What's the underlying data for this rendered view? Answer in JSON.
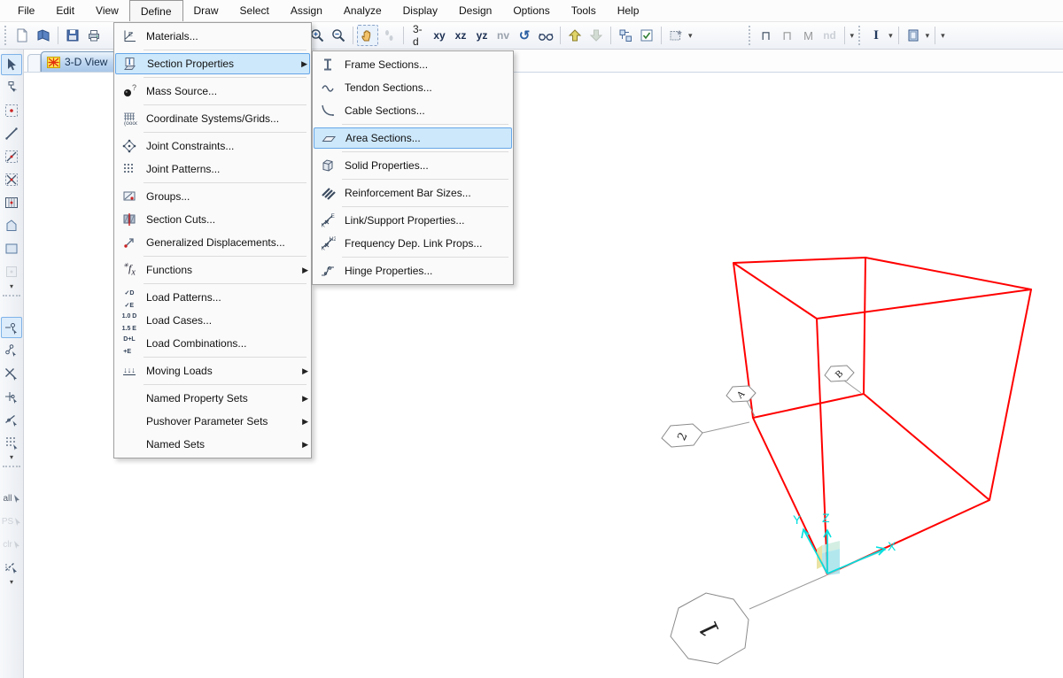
{
  "menubar": {
    "items": [
      "File",
      "Edit",
      "View",
      "Define",
      "Draw",
      "Select",
      "Assign",
      "Analyze",
      "Display",
      "Design",
      "Options",
      "Tools",
      "Help"
    ],
    "open_item": "Define"
  },
  "glyphs": {
    "submenu_arrow": "▶",
    "dropdown_arrow": "▾"
  },
  "toolbar": {
    "labels": {
      "view_3d": "3-d",
      "plane_xy": "xy",
      "plane_xz": "xz",
      "plane_yz": "yz",
      "plane_nv": "nv",
      "nd": "nd",
      "i_beam": "I",
      "frame_a": "⊓",
      "frame_b": "⊓",
      "frame_c": "M"
    },
    "icons": [
      "new-file",
      "open-file",
      "save-file",
      "print",
      "zoom-in",
      "zoom-out",
      "pan",
      "walk-steps",
      "rotate-3d",
      "perspective-glasses",
      "move-up",
      "move-down",
      "select-objects",
      "options-checkbox",
      "assign-template",
      "i-cursor",
      "area-display"
    ]
  },
  "tab_bar": {
    "tabs": [
      {
        "label": "3-D View",
        "icon": "3d-view-icon"
      }
    ]
  },
  "left_toolbar": {
    "labels": {
      "select_all": "all",
      "previous_selection": "PS",
      "clear_selection": "clr"
    },
    "icons": [
      "select-pointer",
      "reshape-object",
      "draw-joint",
      "draw-frame",
      "quick-draw-frame",
      "quick-draw-braces",
      "quick-draw-secondary-beams",
      "draw-poly-area",
      "draw-rect-area",
      "quick-draw-area",
      "snap-to-joints",
      "snap-to-midpoints",
      "snap-to-intersections",
      "snap-to-perpendicular",
      "snap-to-lines",
      "snap-to-grid",
      "select-all",
      "get-previous-selection",
      "clear-selection",
      "crossing-line-select"
    ]
  },
  "define_menu": {
    "items": [
      {
        "label": "Materials...",
        "icon": "materials-icon"
      },
      {
        "label": "Section Properties",
        "icon": "section-properties-icon",
        "submenu": true,
        "highlighted": true
      },
      {
        "label": "Mass Source...",
        "icon": "mass-source-icon"
      },
      {
        "label": "Coordinate Systems/Grids...",
        "icon": "coordinate-grids-icon"
      },
      {
        "label": "Joint Constraints...",
        "icon": "joint-constraints-icon"
      },
      {
        "label": "Joint Patterns...",
        "icon": "joint-patterns-icon"
      },
      {
        "label": "Groups...",
        "icon": "groups-icon"
      },
      {
        "label": "Section Cuts...",
        "icon": "section-cuts-icon"
      },
      {
        "label": "Generalized Displacements...",
        "icon": "generalized-displacements-icon"
      },
      {
        "label": "Functions",
        "icon": "functions-icon",
        "submenu": true
      },
      {
        "label": "Load Patterns...",
        "icon": "load-patterns-icon",
        "icon_text": [
          "✓D",
          "✓E"
        ]
      },
      {
        "label": "Load Cases...",
        "icon": "load-cases-icon",
        "icon_text": [
          "1.0 D",
          "1.5 E"
        ]
      },
      {
        "label": "Load Combinations...",
        "icon": "load-combinations-icon",
        "icon_text": [
          "D+L",
          "+E"
        ]
      },
      {
        "label": "Moving Loads",
        "icon": "moving-loads-icon",
        "icon_text": [
          "↓↓↓"
        ],
        "submenu": true
      },
      {
        "label": "Named Property Sets",
        "submenu": true
      },
      {
        "label": "Pushover Parameter Sets",
        "submenu": true
      },
      {
        "label": "Named Sets",
        "submenu": true
      }
    ]
  },
  "section_properties_submenu": {
    "items": [
      {
        "label": "Frame Sections...",
        "icon": "frame-sections-icon"
      },
      {
        "label": "Tendon Sections...",
        "icon": "tendon-sections-icon"
      },
      {
        "label": "Cable Sections...",
        "icon": "cable-sections-icon"
      },
      {
        "label": "Area Sections...",
        "icon": "area-sections-icon",
        "highlighted": true
      },
      {
        "label": "Solid Properties...",
        "icon": "solid-properties-icon"
      },
      {
        "label": "Reinforcement Bar Sizes...",
        "icon": "reinforcement-bar-sizes-icon"
      },
      {
        "label": "Link/Support Properties...",
        "icon": "link-support-properties-icon",
        "icon_letters": {
          "k": "K",
          "tag": "E"
        }
      },
      {
        "label": "Frequency Dep. Link Props...",
        "icon": "frequency-dep-link-icon",
        "icon_letters": {
          "k": "K",
          "tag": "H2"
        }
      },
      {
        "label": "Hinge Properties...",
        "icon": "hinge-properties-icon"
      }
    ]
  },
  "viewport": {
    "axis_labels": {
      "x": "X",
      "y": "Y",
      "z": "Z"
    },
    "grid_bubbles": [
      {
        "id": "A"
      },
      {
        "id": "B"
      },
      {
        "id": "2"
      },
      {
        "id": "1"
      }
    ],
    "colors": {
      "wireframe": "#ff0000",
      "axes": "#00dfdf",
      "highlight_fill": "#cde8fb",
      "highlight_border": "#66a7e8"
    }
  }
}
